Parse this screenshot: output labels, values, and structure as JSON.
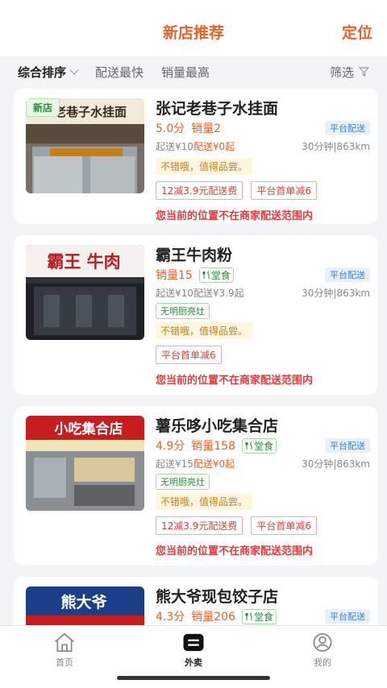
{
  "header": {
    "title": "新店推荐",
    "locate": "定位"
  },
  "sortbar": {
    "items": [
      "综合排序",
      "配送最快",
      "销量最高"
    ],
    "filter": "筛选"
  },
  "stores": [
    {
      "name": "张记老巷子水挂面",
      "badge": "新店",
      "sign_text": "老巷子水挂面",
      "score": "5.0分",
      "sales": "销量2",
      "dine": "",
      "platform": "平台配送",
      "fee_min": "起送¥10",
      "fee_delivery": "配送¥0起",
      "eta": "30分钟|863km",
      "green_tag": "",
      "review": "不错哦，值得品尝。",
      "promos": [
        "12减3.9元配送费",
        "平台首单减6"
      ],
      "warning": "您当前的位置不在商家配送范围内"
    },
    {
      "name": "霸王牛肉粉",
      "badge": "",
      "sign_text": "霸王 牛肉",
      "score": "",
      "sales": "销量15",
      "dine": "堂食",
      "platform": "平台配送",
      "fee_min": "起送¥10",
      "fee_delivery": "配送¥3.9起",
      "eta": "30分钟|863km",
      "green_tag": "无明厨亮灶",
      "review": "不错哦，值得品尝。",
      "promos": [
        "平台首单减6"
      ],
      "warning": "您当前的位置不在商家配送范围内"
    },
    {
      "name": "薯乐哆小吃集合店",
      "badge": "",
      "sign_text": "小吃集合店",
      "score": "4.9分",
      "sales": "销量158",
      "dine": "堂食",
      "platform": "平台配送",
      "fee_min": "起送¥15",
      "fee_delivery": "配送¥0起",
      "eta": "30分钟|863km",
      "green_tag": "无明厨亮灶",
      "review": "不错哦，值得品尝。",
      "promos": [
        "12减3.9元配送费",
        "平台首单减6"
      ],
      "warning": "您当前的位置不在商家配送范围内"
    },
    {
      "name": "熊大爷现包饺子店",
      "badge": "",
      "sign_text": "熊大爷",
      "score": "4.3分",
      "sales": "销量206",
      "dine": "堂食",
      "platform": "平台配送"
    }
  ],
  "tabbar": {
    "home": "首页",
    "takeout": "外卖",
    "mine": "我的"
  },
  "colors": {
    "accent": "#e8612c",
    "warning": "#e33b3b",
    "green": "#2a8a3a",
    "platform": "#3b7dd8"
  }
}
